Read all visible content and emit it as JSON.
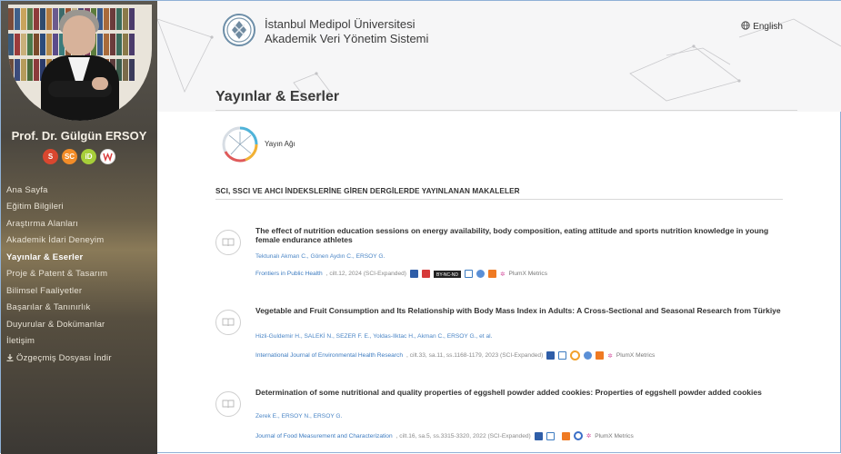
{
  "sidebar": {
    "name": "Prof. Dr. Gülgün ERSOY",
    "badges": [
      {
        "label": "S",
        "color": "#d9472f"
      },
      {
        "label": "SC",
        "color": "#f28c28"
      },
      {
        "label": "iD",
        "color": "#a6ce39"
      },
      {
        "label": "WoS",
        "color": "#d93b3b"
      }
    ],
    "nav": [
      {
        "label": "Ana Sayfa"
      },
      {
        "label": "Eğitim Bilgileri"
      },
      {
        "label": "Araştırma Alanları"
      },
      {
        "label": "Akademik İdari Deneyim"
      },
      {
        "label": "Yayınlar & Eserler",
        "active": true
      },
      {
        "label": "Proje & Patent & Tasarım"
      },
      {
        "label": "Bilimsel Faaliyetler"
      },
      {
        "label": "Başarılar & Tanınırlık"
      },
      {
        "label": "Duyurular & Dokümanlar"
      },
      {
        "label": "İletişim"
      },
      {
        "label": "Özgeçmiş Dosyası İndir"
      }
    ]
  },
  "header": {
    "uni_line1": "İstanbul Medipol Üniversitesi",
    "uni_line2": "Akademik Veri Yönetim Sistemi",
    "language": "English",
    "page_title": "Yayınlar & Eserler"
  },
  "content": {
    "network_label": "Yayın Ağı",
    "section_title": "SCI, SSCI VE AHCI İNDEKSLERİNE GİREN DERGİLERDE YAYINLANAN MAKALELER",
    "publications": [
      {
        "title": "The effect of nutrition education sessions on energy availability, body composition, eating attitude and sports nutrition knowledge in young female endurance athletes",
        "authors": "Tektunalı Akman C., Gönen Aydın C., ERSOY G.",
        "journal": "Frontiers in Public Health",
        "details": ", cilt.12, 2024 (SCI-Expanded)",
        "cc": "BY-NC-ND",
        "plumx": "PlumX Metrics"
      },
      {
        "title": "Vegetable and Fruit Consumption and Its Relationship with Body Mass Index in Adults: A Cross-Sectional and Seasonal Research from Türkiye",
        "authors": "Hizli-Guldemir H., SALEKİ N., SEZER F. E., Yoldas-Ilktac H., Akman C., ERSOY G., et al.",
        "journal": "International Journal of Environmental Health Research",
        "details": ", cilt.33, sa.11, ss.1168-1179, 2023 (SCI-Expanded)",
        "plumx": "PlumX Metrics"
      },
      {
        "title": "Determination of some nutritional and quality properties of eggshell powder added cookies: Properties of eggshell powder added cookies",
        "authors": "Zerek E., ERSOY N., ERSOY G.",
        "journal": "Journal of Food Measurement and Characterization",
        "details": ", cilt.16, sa.5, ss.3315-3320, 2022 (SCI-Expanded)",
        "plumx": "PlumX Metrics"
      }
    ]
  },
  "colors": {
    "sidebar_bg": "#3d3a36",
    "link_blue": "#3c7bc0",
    "header_bg": "#f6f6f7"
  }
}
